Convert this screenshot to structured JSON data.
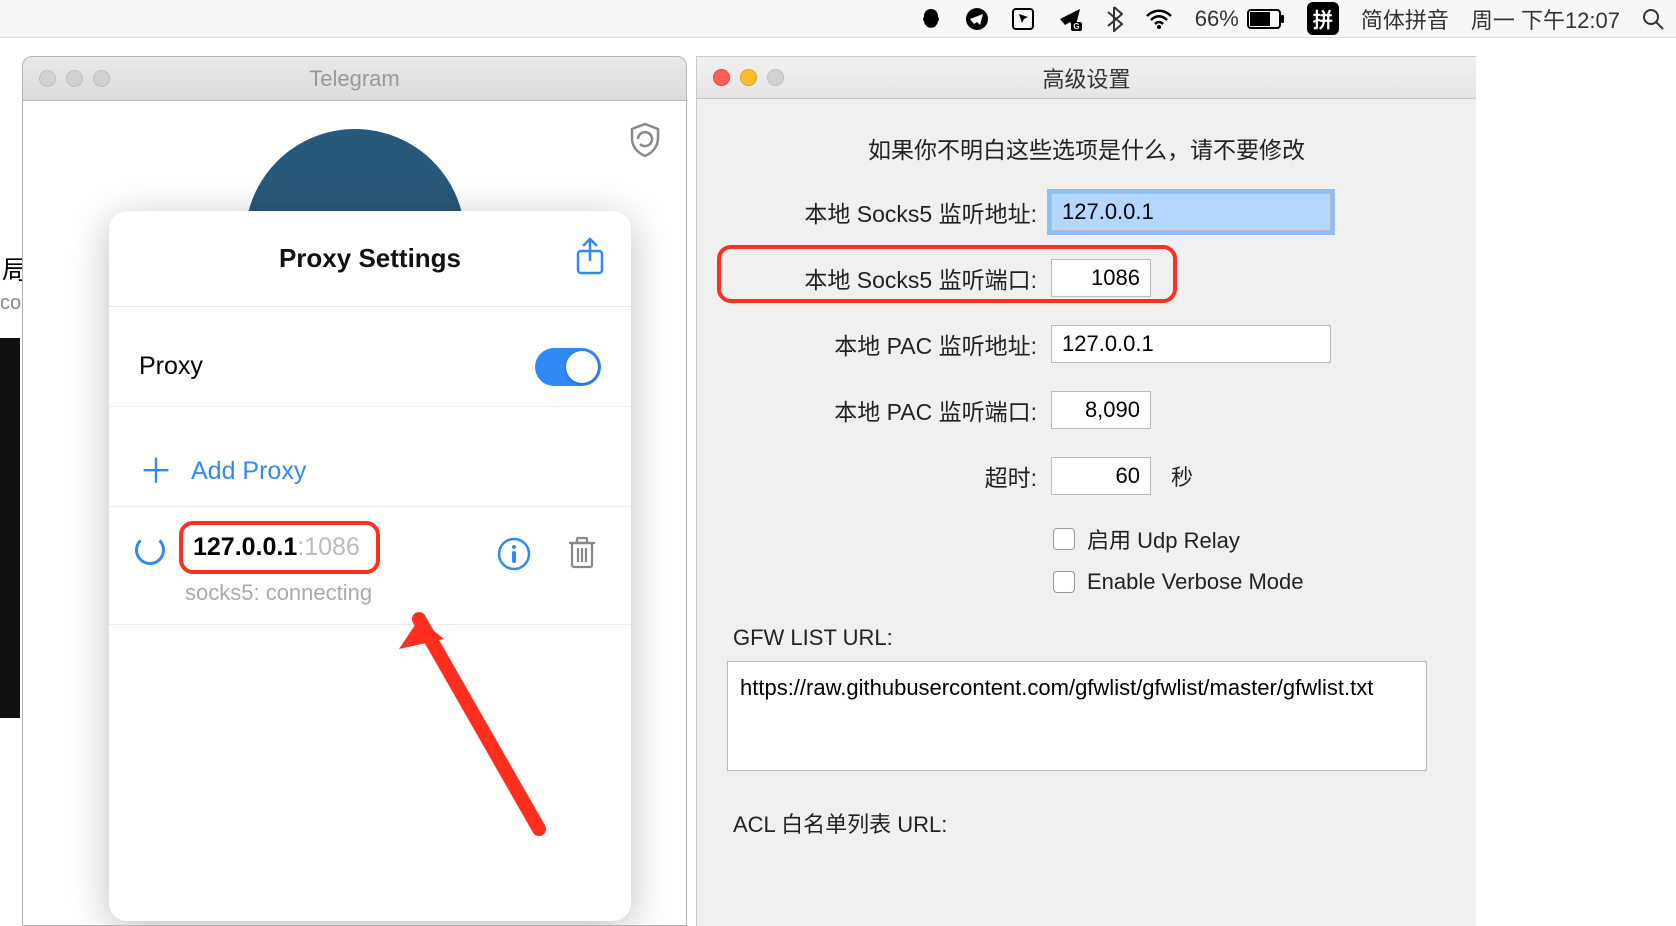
{
  "menubar": {
    "battery_pct": "66%",
    "ime_badge": "拼",
    "ime_name": "简体拼音",
    "datetime": "周一 下午12:07"
  },
  "telegram": {
    "window_title": "Telegram",
    "popup_title": "Proxy Settings",
    "proxy_label": "Proxy",
    "add_proxy_label": "Add Proxy",
    "proxy_ip": "127.0.0.1",
    "proxy_port": ":1086",
    "proxy_status": "socks5: connecting"
  },
  "left_edge": {
    "line1": "局",
    "line2": "co"
  },
  "advanced": {
    "window_title": "高级设置",
    "warning": "如果你不明白这些选项是什么，请不要修改",
    "rows": {
      "socks5_addr_label": "本地 Socks5 监听地址:",
      "socks5_addr_value": "127.0.0.1",
      "socks5_port_label": "本地 Socks5 监听端口:",
      "socks5_port_value": "1086",
      "pac_addr_label": "本地 PAC 监听地址:",
      "pac_addr_value": "127.0.0.1",
      "pac_port_label": "本地 PAC 监听端口:",
      "pac_port_value": "8,090",
      "timeout_label": "超时:",
      "timeout_value": "60",
      "timeout_unit": "秒",
      "udp_relay_label": "启用 Udp Relay",
      "verbose_label": "Enable Verbose Mode"
    },
    "gfw_label": "GFW LIST URL:",
    "gfw_url": "https://raw.githubusercontent.com/gfwlist/gfwlist/master/gfwlist.txt",
    "acl_label": "ACL 白名单列表 URL:"
  }
}
